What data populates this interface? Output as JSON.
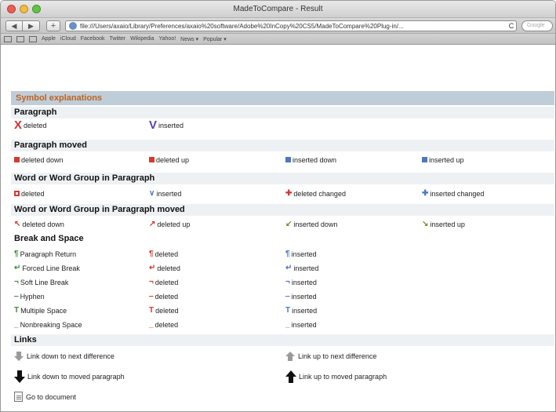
{
  "window": {
    "title": "MadeToCompare - Result",
    "url": "file:///Users/axaio/Library/Preferences/axaio%20software/Adobe%20InCopy%20CS5/MadeToCompare%20Plug-in/...",
    "reload_icon": "C",
    "search_placeholder": "Google"
  },
  "bookmarks": [
    "Apple",
    "iCloud",
    "Facebook",
    "Twitter",
    "Wikipedia",
    "Yahoo!",
    "News ▾",
    "Popular ▾"
  ],
  "header": "Symbol explanations",
  "sections": {
    "paragraph": {
      "title": "Paragraph",
      "items": [
        {
          "label": "deleted",
          "icon": "big-x-icon"
        },
        {
          "label": "inserted",
          "icon": "big-v-icon"
        }
      ]
    },
    "paragraph_moved": {
      "title": "Paragraph moved",
      "items": [
        {
          "label": "deleted down",
          "icon": "square-red-icon"
        },
        {
          "label": "deleted up",
          "icon": "square-red-icon"
        },
        {
          "label": "inserted down",
          "icon": "square-blue-icon"
        },
        {
          "label": "inserted up",
          "icon": "square-blue-icon"
        }
      ]
    },
    "word_group": {
      "title": "Word or Word Group in Paragraph",
      "items": [
        {
          "label": "deleted",
          "icon": "box-red-icon"
        },
        {
          "label": "inserted",
          "icon": "caret-blue-icon"
        },
        {
          "label": "deleted changed",
          "icon": "plus-red-icon"
        },
        {
          "label": "inserted changed",
          "icon": "plus-blue-icon"
        }
      ]
    },
    "word_group_moved": {
      "title": "Word or Word Group in Paragraph moved",
      "items": [
        {
          "label": "deleted down",
          "icon": "arrow-red-icon"
        },
        {
          "label": "deleted up",
          "icon": "arrow-red-icon"
        },
        {
          "label": "inserted down",
          "icon": "arrow-olive-icon"
        },
        {
          "label": "inserted up",
          "icon": "arrow-olive-icon"
        }
      ]
    },
    "break_space": {
      "title": "Break and Space",
      "rows": [
        {
          "name": "Paragraph Return",
          "deleted": "deleted",
          "inserted": "inserted",
          "glyph": "¶"
        },
        {
          "name": "Forced Line Break",
          "deleted": "deleted",
          "inserted": "inserted",
          "glyph": "↵"
        },
        {
          "name": "Soft Line Break",
          "deleted": "deleted",
          "inserted": "inserted",
          "glyph": "¬"
        },
        {
          "name": "Hyphen",
          "deleted": "deleted",
          "inserted": "inserted",
          "glyph": "‒"
        },
        {
          "name": "Multiple Space",
          "deleted": "deleted",
          "inserted": "inserted",
          "glyph": "T"
        },
        {
          "name": "Nonbreaking Space",
          "deleted": "deleted",
          "inserted": "inserted",
          "glyph": "_"
        }
      ]
    },
    "links": {
      "title": "Links",
      "items": [
        {
          "label": "Link down to next difference",
          "icon": "gray-down-arrow-icon"
        },
        {
          "label": "Link up to next difference",
          "icon": "gray-up-arrow-icon"
        },
        {
          "label": "Link down to moved paragraph",
          "icon": "black-down-arrow-icon"
        },
        {
          "label": "Link up to moved paragraph",
          "icon": "black-up-arrow-icon"
        },
        {
          "label": "Go to document",
          "icon": "document-icon"
        }
      ]
    }
  },
  "colors": {
    "header_bg": "#bfcdd9",
    "header_text": "#c0621e",
    "section_bg": "#eef1f4",
    "deleted": "#d63a2f",
    "inserted": "#4a78c2"
  }
}
